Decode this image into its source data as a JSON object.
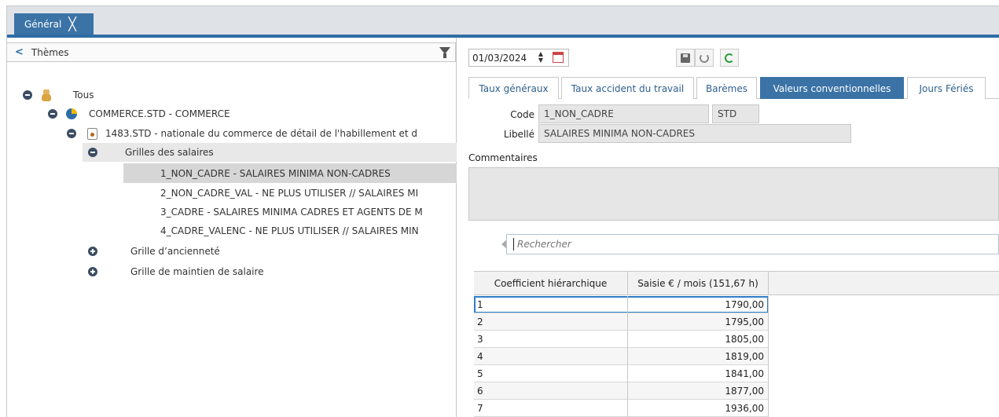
{
  "tabs": {
    "main_label": "Général",
    "close_glyph": "╳"
  },
  "themes_panel": {
    "title": "Thèmes",
    "back_glyph": "<",
    "tree": [
      {
        "label": "Tous"
      },
      {
        "label": "COMMERCE.STD - COMMERCE"
      },
      {
        "label": "1483.STD - nationale du commerce de détail de l'habillement et d"
      },
      {
        "label": "Grilles des salaires"
      },
      {
        "label": "1_NON_CADRE - SALAIRES MINIMA NON-CADRES"
      },
      {
        "label": "2_NON_CADRE_VAL - NE PLUS UTILISER // SALAIRES MI"
      },
      {
        "label": "3_CADRE - SALAIRES MINIMA CADRES ET AGENTS DE M"
      },
      {
        "label": "4_CADRE_VALENC - NE PLUS UTILISER // SALAIRES MIN"
      },
      {
        "label": "Grille d’ancienneté"
      },
      {
        "label": "Grille de maintien de salaire"
      }
    ]
  },
  "toolbar": {
    "date_value": "01/03/2024",
    "spin_up": "▲",
    "spin_down": "▼"
  },
  "subtabs": [
    {
      "label": "Taux généraux"
    },
    {
      "label": "Taux accident du travail"
    },
    {
      "label": "Barèmes"
    },
    {
      "label": "Valeurs conventionnelles"
    },
    {
      "label": "Jours Fériés"
    }
  ],
  "form": {
    "code_label": "Code",
    "code_value": "1_NON_CADRE",
    "code_suffix": "STD",
    "libelle_label": "Libellé",
    "libelle_value": "SALAIRES MINIMA NON-CADRES",
    "comments_label": "Commentaires",
    "search_placeholder": "Rechercher"
  },
  "grid": {
    "columns": [
      "Coefficient hiérarchique",
      "Saisie € / mois (151,67 h)"
    ],
    "rows": [
      {
        "coef": "1",
        "value": "1790,00"
      },
      {
        "coef": "2",
        "value": "1795,00"
      },
      {
        "coef": "3",
        "value": "1805,00"
      },
      {
        "coef": "4",
        "value": "1819,00"
      },
      {
        "coef": "5",
        "value": "1841,00"
      },
      {
        "coef": "6",
        "value": "1877,00"
      },
      {
        "coef": "7",
        "value": "1936,00"
      }
    ]
  },
  "colors": {
    "accent": "#3b73a6",
    "selection": "#d6d6d6",
    "refresh": "#2a9d3a"
  }
}
